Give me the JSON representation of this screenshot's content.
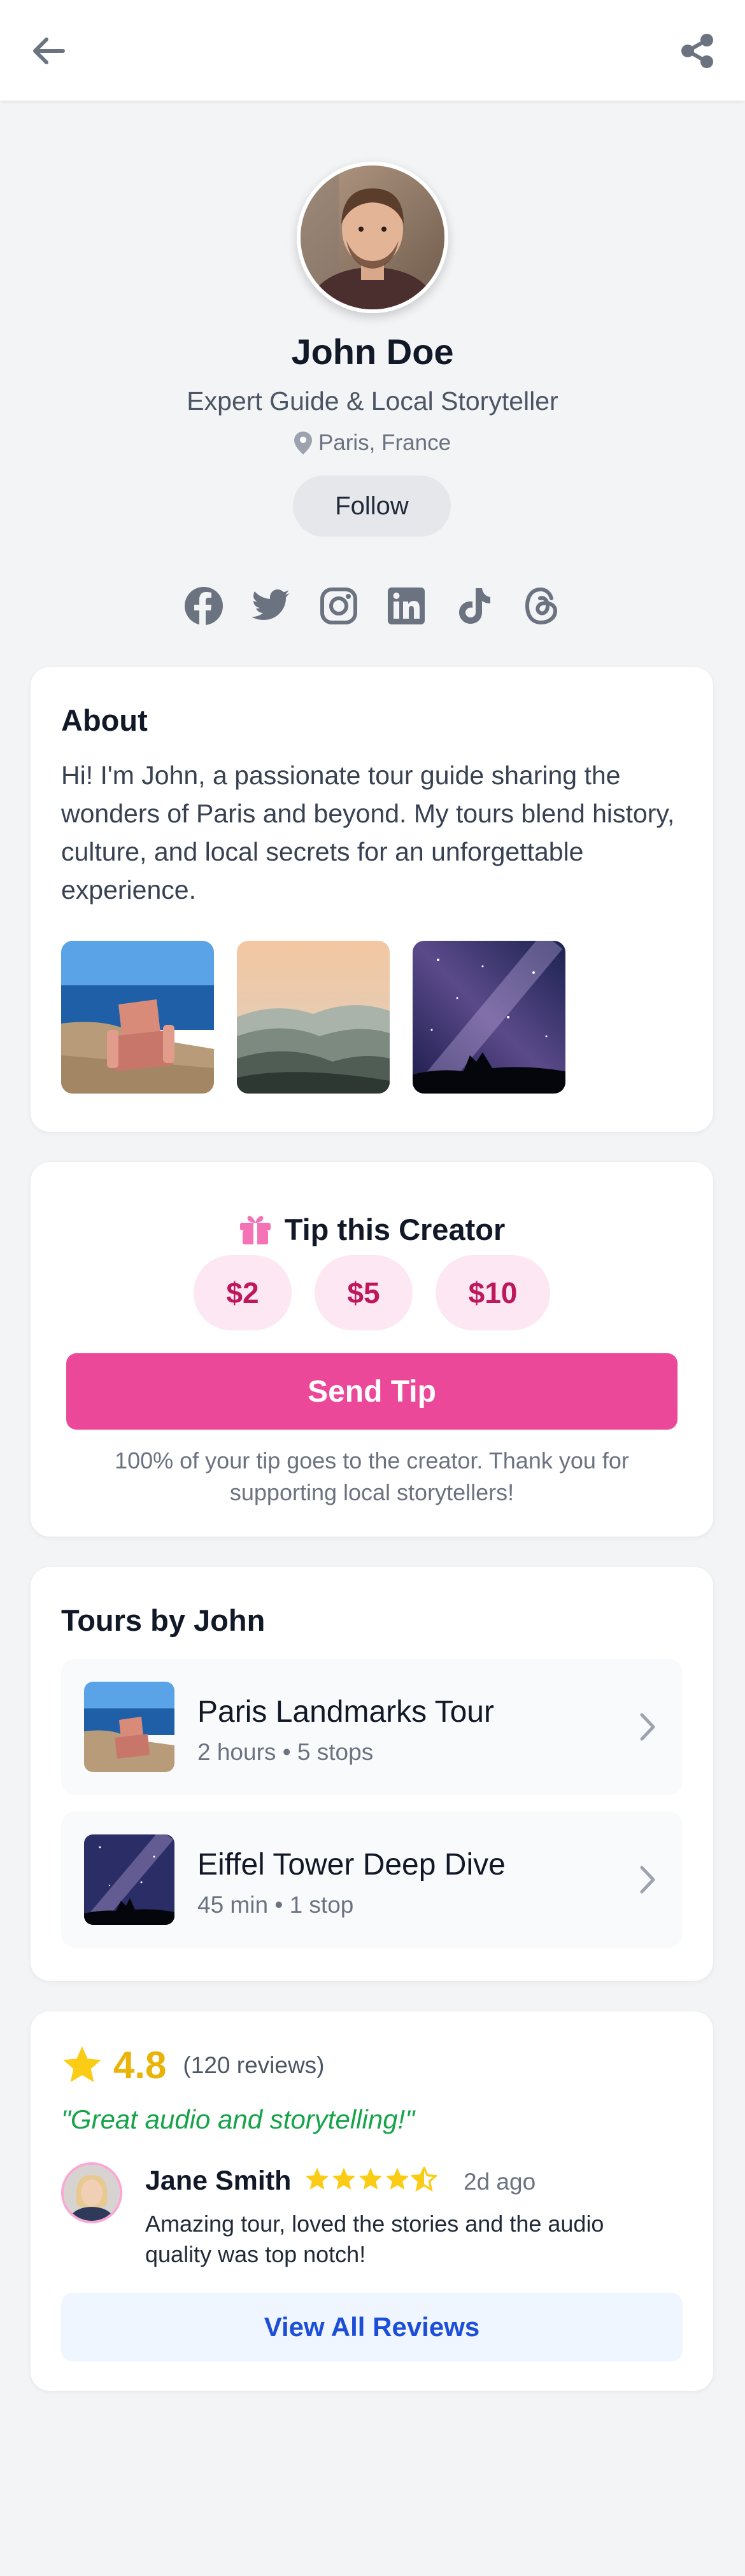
{
  "header": {
    "back_icon": "arrow-left-icon",
    "share_icon": "share-icon"
  },
  "profile": {
    "name": "John Doe",
    "title": "Expert Guide & Local Storyteller",
    "location": "Paris, France",
    "follow_label": "Follow"
  },
  "socials": [
    "facebook-icon",
    "twitter-icon",
    "instagram-icon",
    "linkedin-icon",
    "tiktok-icon",
    "threads-icon"
  ],
  "about": {
    "heading": "About",
    "text": "Hi! I'm John, a passionate tour guide sharing the wonders of Paris and beyond. My tours blend history, culture, and local secrets for an unforgettable experience."
  },
  "tip": {
    "heading": "Tip this Creator",
    "amounts": [
      "$2",
      "$5",
      "$10"
    ],
    "send_label": "Send Tip",
    "note": "100% of your tip goes to the creator. Thank you for supporting local storytellers!"
  },
  "tours": {
    "heading": "Tours by John",
    "items": [
      {
        "title": "Paris Landmarks Tour",
        "meta": "2 hours • 5 stops"
      },
      {
        "title": "Eiffel Tower Deep Dive",
        "meta": "45 min • 1 stop"
      }
    ]
  },
  "reviews": {
    "rating": "4.8",
    "count": "(120 reviews)",
    "quote": "\"Great audio and storytelling!\"",
    "review": {
      "name": "Jane Smith",
      "stars": 4.5,
      "date": "2d ago",
      "text": "Amazing tour, loved the stories and the audio quality was top notch!"
    },
    "view_all_label": "View All Reviews"
  },
  "colors": {
    "accent_pink": "#ec4899",
    "star_yellow": "#eab308",
    "quote_green": "#16a34a",
    "link_blue": "#1d4ed8"
  }
}
